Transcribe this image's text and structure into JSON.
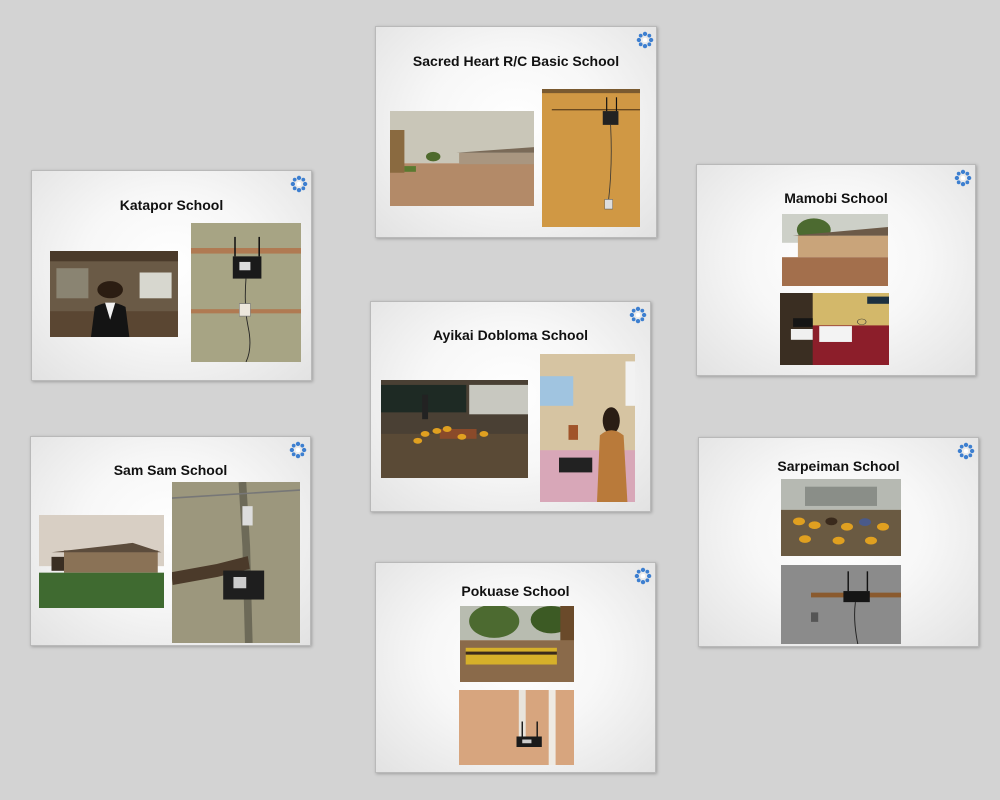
{
  "brand": {
    "logo_icon": "flower-logo-icon",
    "logo_color": "#3d7fd0"
  },
  "slides": [
    {
      "id": "sacred-heart",
      "title": "Sacred Heart R/C Basic School",
      "photos": [
        "school-courtyard-photo",
        "wall-mounted-device-photo"
      ]
    },
    {
      "id": "katapor",
      "title": "Katapor School",
      "photos": [
        "teacher-classroom-photo",
        "wall-mounted-device-photo"
      ]
    },
    {
      "id": "mamobi",
      "title": "Mamobi School",
      "photos": [
        "school-building-photo",
        "wall-mounted-device-photo"
      ]
    },
    {
      "id": "ayikai-dobloma",
      "title": "Ayikai Dobloma School",
      "photos": [
        "classroom-students-photo",
        "teacher-laptop-photo"
      ]
    },
    {
      "id": "sam-sam",
      "title": "Sam Sam School",
      "photos": [
        "school-building-photo",
        "wall-mounted-device-photo"
      ]
    },
    {
      "id": "sarpeiman",
      "title": "Sarpeiman School",
      "photos": [
        "outdoor-students-photo",
        "wall-mounted-device-photo"
      ]
    },
    {
      "id": "pokuase",
      "title": "Pokuase School",
      "photos": [
        "school-assembly-photo",
        "wall-mounted-device-photo"
      ]
    }
  ]
}
